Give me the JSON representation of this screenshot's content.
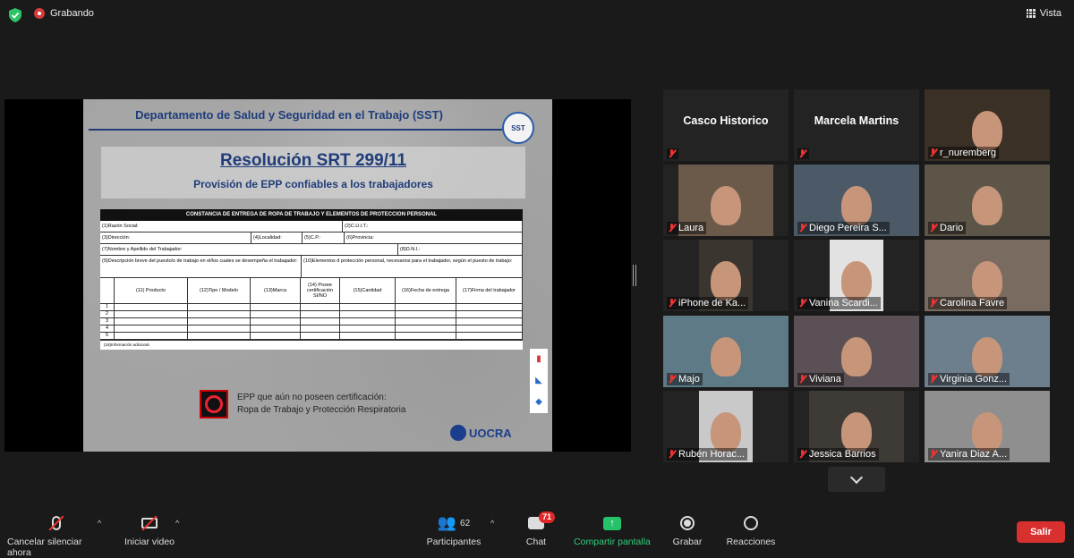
{
  "topbar": {
    "recording_label": "Grabando",
    "view_label": "Vista",
    "colors": {
      "recording": "#d43c3c",
      "shield": "#2ec467"
    }
  },
  "slide": {
    "header": "Departamento de Salud y Seguridad en el Trabajo (SST)",
    "logo_text": "SST",
    "resolution_title": "Resolución SRT 299/11",
    "resolution_subtitle": "Provisión de EPP confiables a los trabajadores",
    "form": {
      "title": "CONSTANCIA DE ENTREGA DE ROPA DE TRABAJO Y ELEMENTOS DE PROTECCION PERSONAL",
      "razon_social": "(1)Razón Social:",
      "cuit": "(2)C.U.I.T.:",
      "direccion": "(3)Dirección:",
      "localidad": "(4)Localidad:",
      "cp": "(5)C.P.:",
      "provincia": "(6)Provincia:",
      "nombre": "(7)Nombre y Apellido del Trabajador:",
      "dni": "(8)D.N.I.:",
      "descripcion": "(9)Descripción breve del puesto/s de trabajo en el/los cuales se desempeña el trabajador:",
      "elementos": "(10)Elementos d protección personal, necesarios para el trabajador, según el puesto de trabajo:",
      "columns": [
        "(11) Producto",
        "(12)Tipo / Modelo",
        "(13)Marca",
        "(14) Posee certificación SI/NO",
        "(15)Cantidad",
        "(16)Fecha de entrega",
        "(17)Firma del trabajador"
      ],
      "rows": [
        "1",
        "2",
        "3",
        "4",
        "5"
      ],
      "info": "(18)Información adicional."
    },
    "epp_line1": "EPP que aún no poseen certificación:",
    "epp_line2": "Ropa de Trabajo y Protección Respiratoria",
    "uocra": "UOCRA"
  },
  "gallery": [
    {
      "name": "Casco Historico",
      "type": "name"
    },
    {
      "name": "Marcela Martins",
      "type": "name"
    },
    {
      "name": "r_nuremberg",
      "type": "video"
    },
    {
      "name": "Laura",
      "type": "video"
    },
    {
      "name": "Diego Pereira S...",
      "type": "video",
      "active": true
    },
    {
      "name": "Dario",
      "type": "video"
    },
    {
      "name": "iPhone de Ka...",
      "type": "video"
    },
    {
      "name": "Vanina Scardi...",
      "type": "video"
    },
    {
      "name": "Carolina Favre",
      "type": "video"
    },
    {
      "name": "Majo",
      "type": "video"
    },
    {
      "name": "Viviana",
      "type": "video"
    },
    {
      "name": "Virginia Gonz...",
      "type": "video"
    },
    {
      "name": "Rubén Horac...",
      "type": "video"
    },
    {
      "name": "Jessica Barrios",
      "type": "video"
    },
    {
      "name": "Yanira Diaz A...",
      "type": "video"
    }
  ],
  "toolbar": {
    "mute_label": "Cancelar silenciar ahora",
    "video_label": "Iniciar video",
    "participants_label": "Participantes",
    "participants_count": "62",
    "chat_label": "Chat",
    "chat_badge": "71",
    "share_label": "Compartir pantalla",
    "record_label": "Grabar",
    "reactions_label": "Reacciones",
    "leave_label": "Salir",
    "colors": {
      "share": "#26c26a",
      "leave": "#d82f2f",
      "badge": "#e02828"
    }
  }
}
